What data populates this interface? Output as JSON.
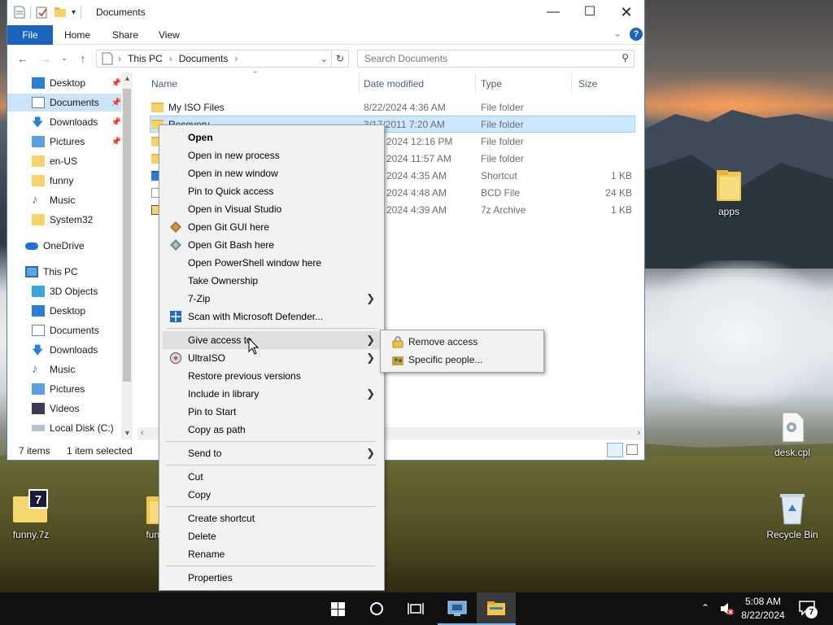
{
  "window": {
    "title": "Documents",
    "ribbon_tabs": [
      "File",
      "Home",
      "Share",
      "View"
    ],
    "address_parts": [
      "This PC",
      "Documents"
    ],
    "search_placeholder": "Search Documents"
  },
  "nav_pane": [
    {
      "label": "Desktop",
      "icon": "desktop-icon",
      "pinned": true
    },
    {
      "label": "Documents",
      "icon": "documents-icon",
      "pinned": true,
      "selected": true
    },
    {
      "label": "Downloads",
      "icon": "downloads-icon",
      "pinned": true
    },
    {
      "label": "Pictures",
      "icon": "pictures-icon",
      "pinned": true
    },
    {
      "label": "en-US",
      "icon": "folder-icon"
    },
    {
      "label": "funny",
      "icon": "folder-icon"
    },
    {
      "label": "Music",
      "icon": "music-icon"
    },
    {
      "label": "System32",
      "icon": "folder-icon"
    },
    {
      "label": "OneDrive",
      "icon": "onedrive-icon"
    },
    {
      "label": "This PC",
      "icon": "this-pc-icon"
    },
    {
      "label": "3D Objects",
      "icon": "3d-objects-icon"
    },
    {
      "label": "Desktop",
      "icon": "desktop-icon"
    },
    {
      "label": "Documents",
      "icon": "documents-icon"
    },
    {
      "label": "Downloads",
      "icon": "downloads-icon"
    },
    {
      "label": "Music",
      "icon": "music-icon"
    },
    {
      "label": "Pictures",
      "icon": "pictures-icon"
    },
    {
      "label": "Videos",
      "icon": "videos-icon"
    },
    {
      "label": "Local Disk (C:)",
      "icon": "local-disk-icon"
    }
  ],
  "columns": [
    "Name",
    "Date modified",
    "Type",
    "Size"
  ],
  "files": [
    {
      "name": "My ISO Files",
      "date": "8/22/2024 4:36 AM",
      "type": "File folder",
      "size": ""
    },
    {
      "name": "Recovery",
      "date": "3/17/2011 7:20 AM",
      "type": "File folder",
      "size": "",
      "selected": true
    },
    {
      "name": "",
      "date": "2024 12:16 PM",
      "type": "File folder",
      "size": ""
    },
    {
      "name": "",
      "date": "2024 11:57 AM",
      "type": "File folder",
      "size": ""
    },
    {
      "name": "",
      "date": "2024 4:35 AM",
      "type": "Shortcut",
      "size": "1 KB"
    },
    {
      "name": "",
      "date": "2024 4:48 AM",
      "type": "BCD File",
      "size": "24 KB"
    },
    {
      "name": "",
      "date": "2024 4:39 AM",
      "type": "7z Archive",
      "size": "1 KB"
    }
  ],
  "status": {
    "items": "7 items",
    "selected": "1 item selected"
  },
  "context_menu": {
    "items": [
      {
        "label": "Open",
        "bold": true
      },
      {
        "label": "Open in new process"
      },
      {
        "label": "Open in new window"
      },
      {
        "label": "Pin to Quick access"
      },
      {
        "label": "Open in Visual Studio"
      },
      {
        "label": "Open Git GUI here",
        "icon": "git-gui-icon"
      },
      {
        "label": "Open Git Bash here",
        "icon": "git-bash-icon"
      },
      {
        "label": "Open PowerShell window here"
      },
      {
        "label": "Take Ownership"
      },
      {
        "label": "7-Zip",
        "submenu": true
      },
      {
        "label": "Scan with Microsoft Defender...",
        "icon": "defender-icon"
      },
      {
        "label": "Give access to",
        "submenu": true,
        "hover": true
      },
      {
        "label": "UltraISO",
        "submenu": true,
        "icon": "ultraiso-icon"
      },
      {
        "label": "Restore previous versions"
      },
      {
        "label": "Include in library",
        "submenu": true
      },
      {
        "label": "Pin to Start"
      },
      {
        "label": "Copy as path"
      },
      {
        "label": "Send to",
        "submenu": true
      },
      {
        "label": "Cut"
      },
      {
        "label": "Copy"
      },
      {
        "label": "Create shortcut"
      },
      {
        "label": "Delete"
      },
      {
        "label": "Rename"
      },
      {
        "label": "Properties"
      }
    ]
  },
  "submenu": {
    "items": [
      {
        "label": "Remove access",
        "icon": "lock-icon"
      },
      {
        "label": "Specific people...",
        "icon": "people-icon"
      }
    ]
  },
  "desktop_icons": [
    {
      "label": "apps",
      "icon": "folder-icon"
    },
    {
      "label": "desk.cpl",
      "icon": "settings-file-icon"
    },
    {
      "label": "Recycle Bin",
      "icon": "recycle-bin-icon"
    },
    {
      "label": "funny.7z",
      "icon": "7z-archive-icon"
    },
    {
      "label": "fun",
      "icon": "folder-icon"
    }
  ],
  "taskbar": {
    "time": "5:08 AM",
    "date": "8/22/2024",
    "notification_count": "7"
  },
  "colors": {
    "accent": "#1a64c0",
    "selection": "#cce8ff",
    "taskbar": "#101010"
  }
}
